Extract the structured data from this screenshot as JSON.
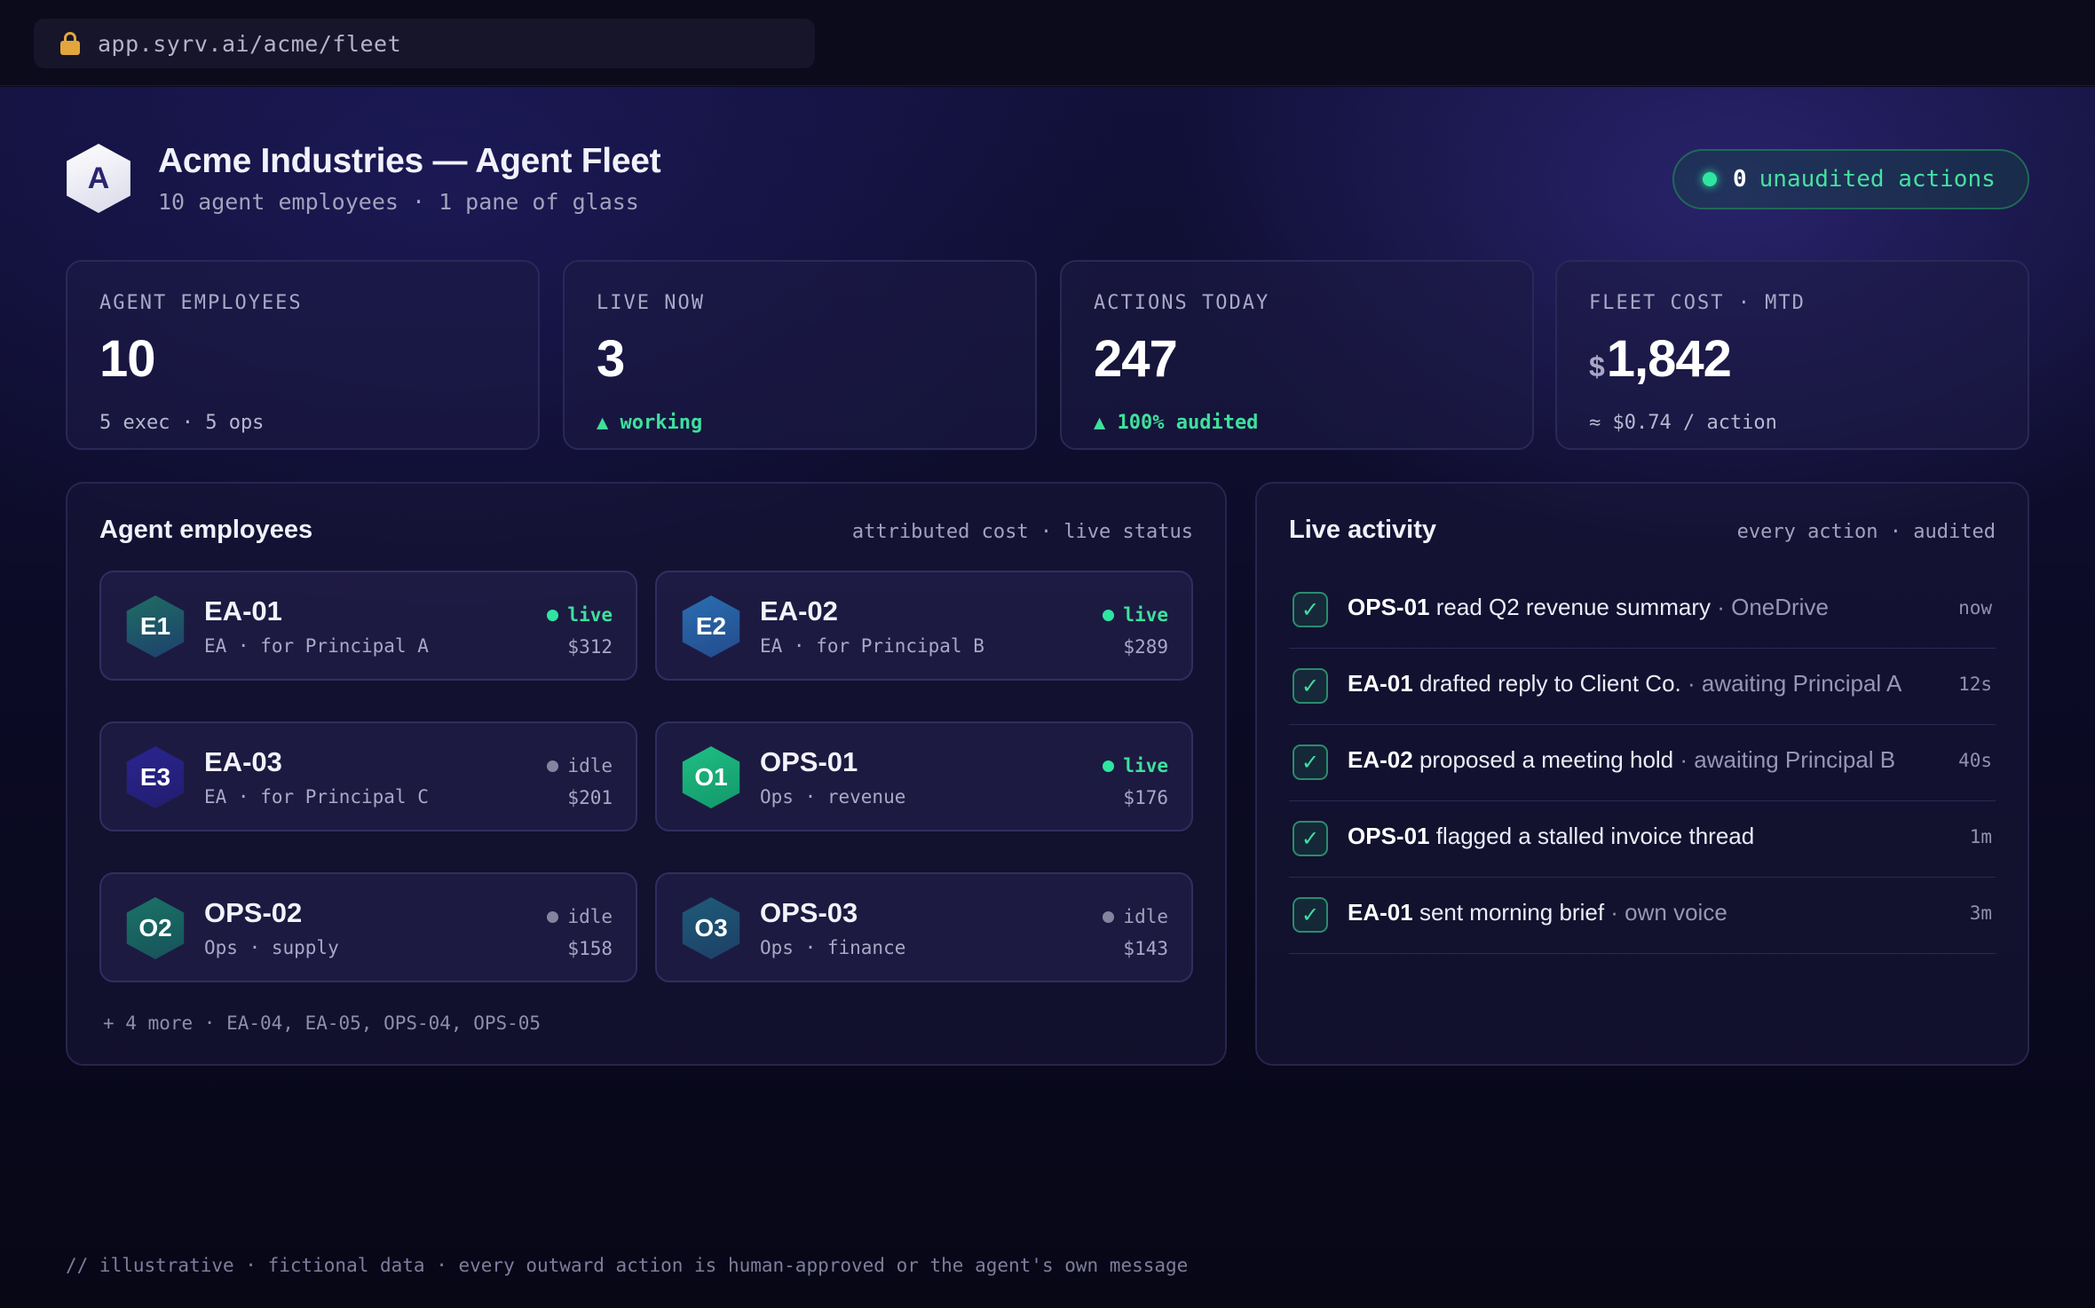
{
  "browser": {
    "url": "app.syrv.ai/acme/fleet",
    "lock_icon": "lock-icon"
  },
  "header": {
    "logo_letter": "A",
    "title": "Acme Industries — Agent Fleet",
    "subtitle": "10 agent employees · 1 pane of glass",
    "audit_badge": {
      "count": "0",
      "label": "unaudited actions"
    }
  },
  "stats": [
    {
      "label": "AGENT EMPLOYEES",
      "value": "10",
      "footnote": "5 exec · 5 ops",
      "accent": ""
    },
    {
      "label": "LIVE NOW",
      "value": "3",
      "footnote": "▲ working",
      "accent": "green"
    },
    {
      "label": "ACTIONS TODAY",
      "value": "247",
      "footnote": "▲ 100% audited",
      "accent": "green"
    },
    {
      "label": "FLEET COST · MTD",
      "currency": "$",
      "value": "1,842",
      "footnote": "≈ $0.74 / action",
      "accent": ""
    }
  ],
  "agents_panel": {
    "title": "Agent employees",
    "caption": "attributed cost · live status",
    "agents": [
      {
        "badge": "E1",
        "name": "EA-01",
        "role": "EA · for Principal A",
        "status": "live",
        "cost": "$312",
        "gradient": [
          "#1f6e62",
          "#1d3f6e"
        ]
      },
      {
        "badge": "E2",
        "name": "EA-02",
        "role": "EA · for Principal B",
        "status": "live",
        "cost": "$289",
        "gradient": [
          "#2a6fb2",
          "#234a8c"
        ]
      },
      {
        "badge": "E3",
        "name": "EA-03",
        "role": "EA · for Principal C",
        "status": "idle",
        "cost": "$201",
        "gradient": [
          "#2a2590",
          "#221d6e"
        ]
      },
      {
        "badge": "O1",
        "name": "OPS-01",
        "role": "Ops · revenue",
        "status": "live",
        "cost": "$176",
        "gradient": [
          "#1fbf84",
          "#13976a"
        ]
      },
      {
        "badge": "O2",
        "name": "OPS-02",
        "role": "Ops · supply",
        "status": "idle",
        "cost": "$158",
        "gradient": [
          "#1a7466",
          "#17515a"
        ]
      },
      {
        "badge": "O3",
        "name": "OPS-03",
        "role": "Ops · finance",
        "status": "idle",
        "cost": "$143",
        "gradient": [
          "#1e5c78",
          "#1d3f66"
        ]
      }
    ],
    "more": "+ 4 more · EA-04, EA-05, OPS-04, OPS-05"
  },
  "activity_panel": {
    "title": "Live activity",
    "caption": "every action · audited",
    "items": [
      {
        "agent": "OPS-01",
        "action": "read Q2 revenue summary",
        "detail": "· OneDrive",
        "time": "now"
      },
      {
        "agent": "EA-01",
        "action": "drafted reply to Client Co.",
        "detail": "· awaiting Principal A",
        "time": "12s"
      },
      {
        "agent": "EA-02",
        "action": "proposed a meeting hold",
        "detail": "· awaiting Principal B",
        "time": "40s"
      },
      {
        "agent": "OPS-01",
        "action": "flagged a stalled invoice thread",
        "detail": "",
        "time": "1m"
      },
      {
        "agent": "EA-01",
        "action": "sent morning brief",
        "detail": "· own voice",
        "time": "3m"
      }
    ]
  },
  "footnote": "// illustrative · fictional data · every outward action is human-approved or the agent's own message",
  "colors": {
    "accent_green": "#2ee6a0",
    "background": "#07071a",
    "card_border": "#2a2856"
  }
}
